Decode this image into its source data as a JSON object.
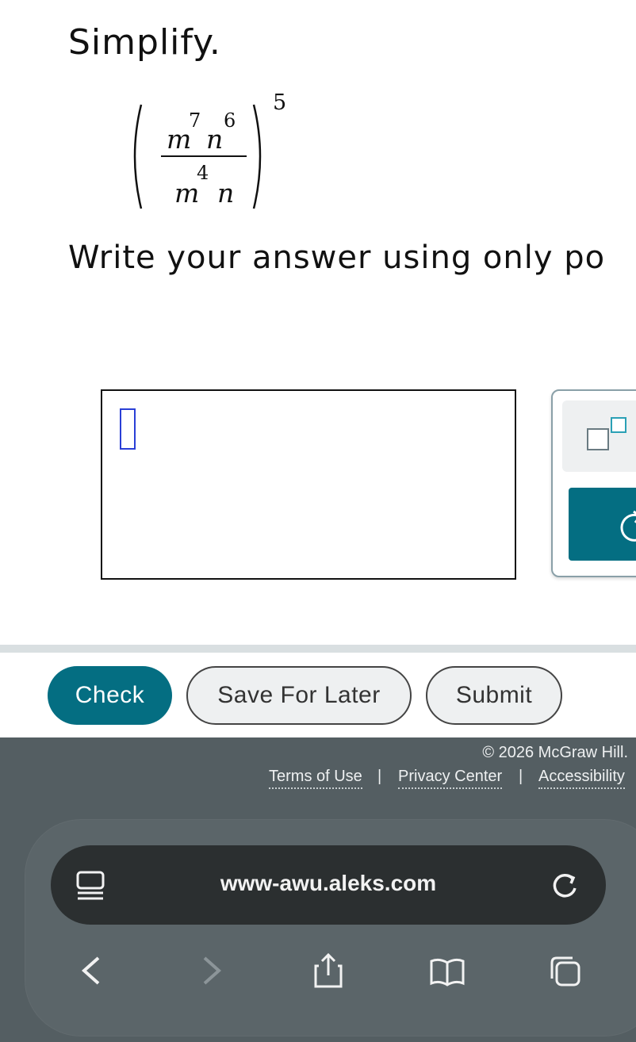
{
  "problem": {
    "title": "Simplify.",
    "expression": {
      "num_var1": "m",
      "num_exp1": "7",
      "num_var2": "n",
      "num_exp2": "6",
      "den_var1": "m",
      "den_exp1": "4",
      "den_var2": "n",
      "outer_exp": "5"
    },
    "instruction": "Write your answer using only po"
  },
  "actions": {
    "check": "Check",
    "save_for_later": "Save For Later",
    "submit": "Submit"
  },
  "footer": {
    "copyright": "© 2026 McGraw Hill.",
    "terms": "Terms of Use",
    "privacy": "Privacy Center",
    "accessibility": "Accessibility",
    "separator": "|"
  },
  "browser": {
    "url": "www-awu.aleks.com"
  },
  "colors": {
    "primary": "#046e82",
    "footer_bg": "#545e62",
    "cursor": "#2a3fd6"
  },
  "icons": {
    "exponent_tool": "superscript-box-icon",
    "undo": "undo-arrow-icon",
    "reader": "reader-mode-icon",
    "reload": "reload-icon",
    "back": "chevron-left-icon",
    "forward": "chevron-right-icon",
    "share": "share-icon",
    "bookmarks": "book-icon",
    "tabs": "tabs-icon"
  }
}
